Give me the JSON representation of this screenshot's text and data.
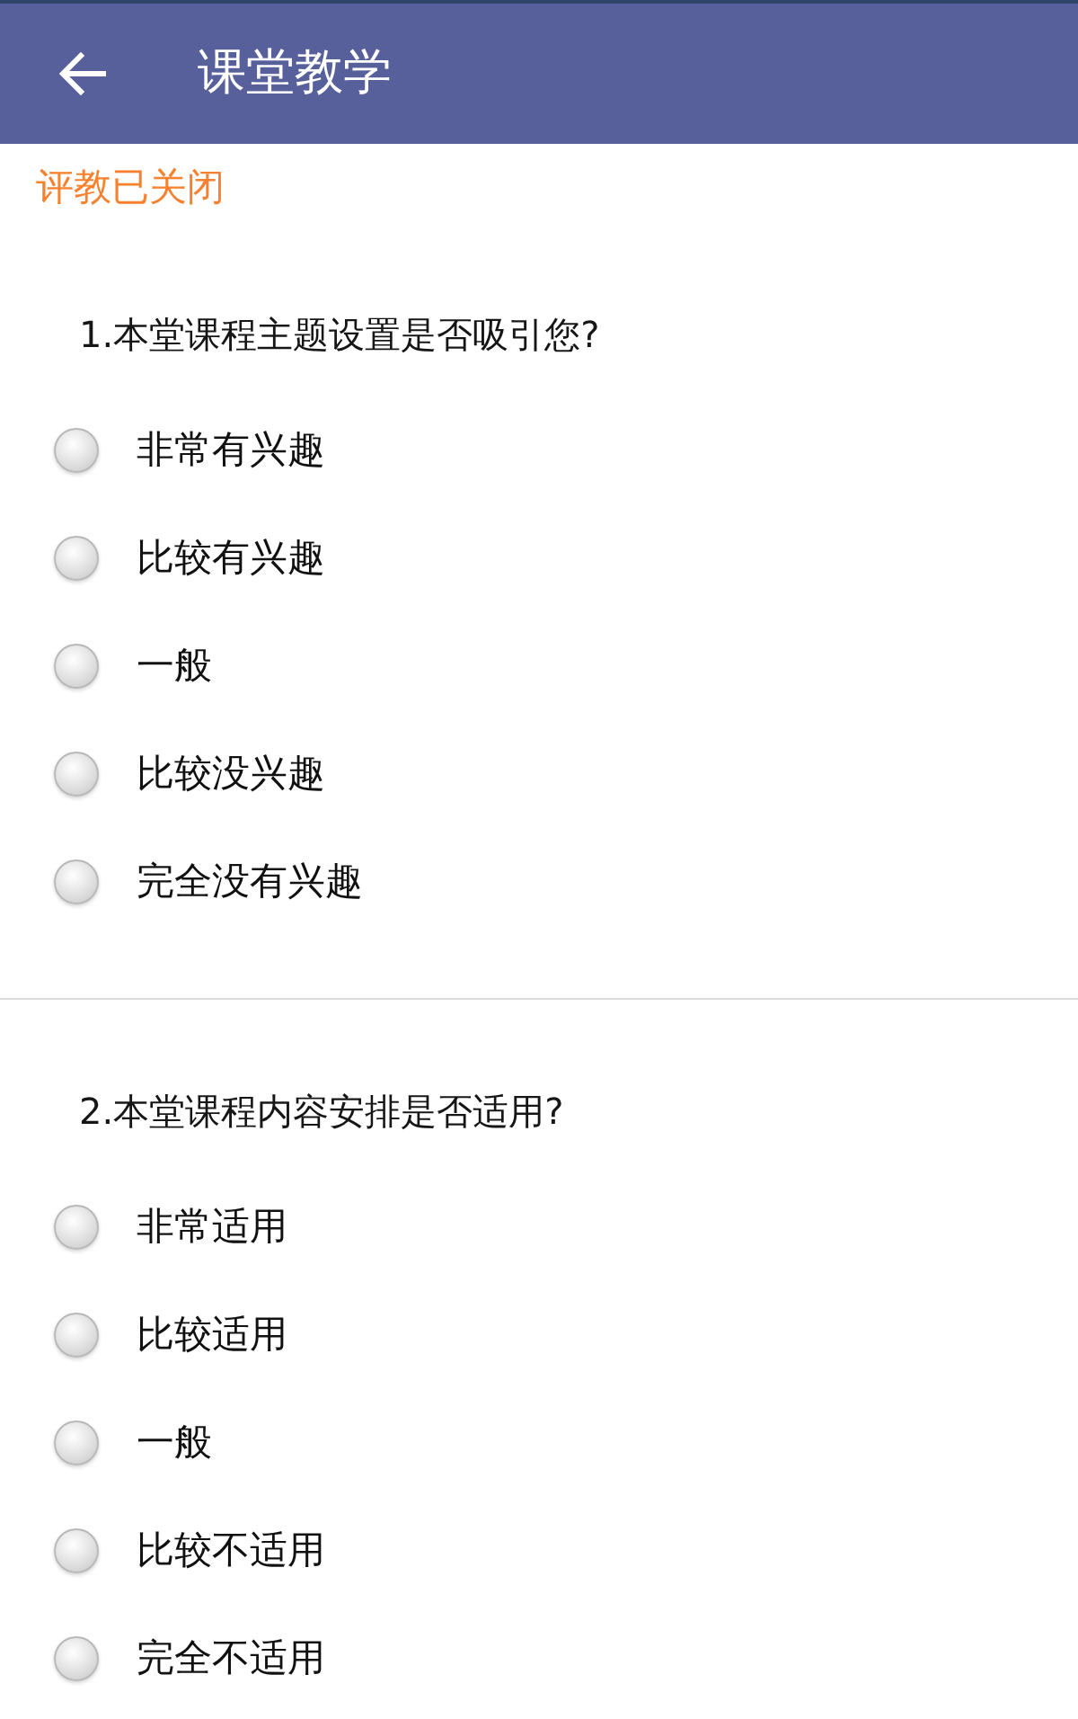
{
  "header": {
    "title": "课堂教学"
  },
  "status": "评教已关闭",
  "questions": [
    {
      "title": "1.本堂课程主题设置是否吸引您?",
      "options": [
        {
          "label": "非常有兴趣",
          "selected": false
        },
        {
          "label": "比较有兴趣",
          "selected": false
        },
        {
          "label": "一般",
          "selected": false
        },
        {
          "label": "比较没兴趣",
          "selected": false
        },
        {
          "label": "完全没有兴趣",
          "selected": false
        }
      ]
    },
    {
      "title": "2.本堂课程内容安排是否适用?",
      "options": [
        {
          "label": "非常适用",
          "selected": false
        },
        {
          "label": "比较适用",
          "selected": false
        },
        {
          "label": "一般",
          "selected": false
        },
        {
          "label": "比较不适用",
          "selected": false
        },
        {
          "label": "完全不适用",
          "selected": false
        }
      ]
    }
  ]
}
